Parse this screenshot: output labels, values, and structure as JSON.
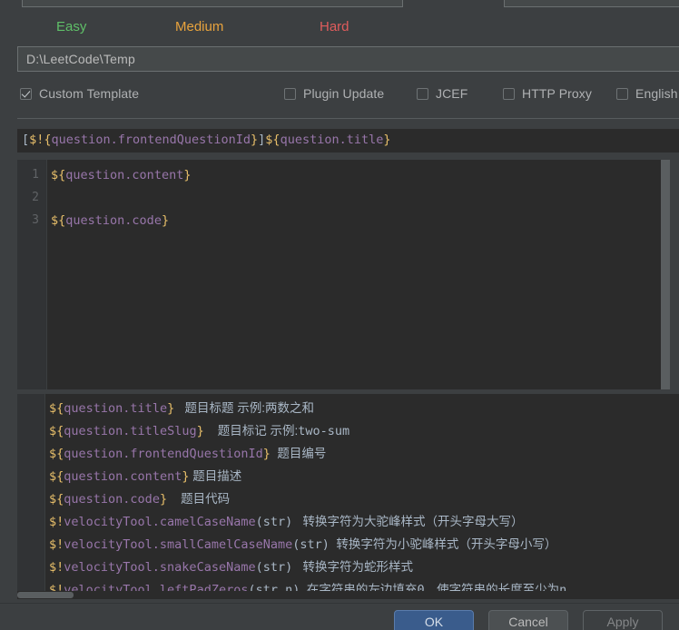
{
  "window": {
    "background": "#3C3F41",
    "editor_background": "#2B2B2B"
  },
  "top_fields": {
    "left_field_value": "",
    "right_field_value": ""
  },
  "difficulty": {
    "items": [
      {
        "label": "Easy",
        "color": "#5FBF68"
      },
      {
        "label": "Medium",
        "color": "#E8A33D"
      },
      {
        "label": "Hard",
        "color": "#E05C5C"
      }
    ]
  },
  "path": {
    "value": "D:\\LeetCode\\Temp",
    "placeholder": "D:\\LeetCode\\Temp"
  },
  "checkboxes": [
    {
      "label": "Custom Template",
      "checked": true
    },
    {
      "label": "Plugin Update",
      "checked": false
    },
    {
      "label": "JCEF",
      "checked": false
    },
    {
      "label": "HTTP Proxy",
      "checked": false
    },
    {
      "label": "English",
      "checked": false
    }
  ],
  "left_glyph": ")",
  "filename_template": {
    "value": "[$!{question.frontendQuestionId}]${question.title}",
    "tokens": [
      {
        "t": "[",
        "c": "tk-punct"
      },
      {
        "t": "$!",
        "c": "tk-dollar"
      },
      {
        "t": "{",
        "c": "tk-brace"
      },
      {
        "t": "question.frontendQuestionId",
        "c": "tk-ident"
      },
      {
        "t": "}",
        "c": "tk-brace"
      },
      {
        "t": "]",
        "c": "tk-punct"
      },
      {
        "t": "$",
        "c": "tk-dollar"
      },
      {
        "t": "{",
        "c": "tk-brace"
      },
      {
        "t": "question.title",
        "c": "tk-ident"
      },
      {
        "t": "}",
        "c": "tk-brace"
      }
    ]
  },
  "code_editor": {
    "lines": [
      {
        "number": "1",
        "text": "${question.content}",
        "tokens": [
          {
            "t": "$",
            "c": "tk-dollar"
          },
          {
            "t": "{",
            "c": "tk-brace"
          },
          {
            "t": "question.content",
            "c": "tk-ident"
          },
          {
            "t": "}",
            "c": "tk-brace"
          }
        ]
      },
      {
        "number": "2",
        "text": "",
        "tokens": []
      },
      {
        "number": "3",
        "text": "${question.code}",
        "tokens": [
          {
            "t": "$",
            "c": "tk-dollar"
          },
          {
            "t": "{",
            "c": "tk-brace"
          },
          {
            "t": "question.code",
            "c": "tk-ident"
          },
          {
            "t": "}",
            "c": "tk-brace"
          }
        ]
      }
    ]
  },
  "hints": {
    "lines": [
      {
        "tokens": [
          {
            "t": "$",
            "c": "tk-dollar"
          },
          {
            "t": "{",
            "c": "tk-brace"
          },
          {
            "t": "question.title",
            "c": "tk-ident"
          },
          {
            "t": "}",
            "c": "tk-brace"
          }
        ],
        "desc": "   题目标题 示例:两数之和",
        "desc_mono": ""
      },
      {
        "tokens": [
          {
            "t": "$",
            "c": "tk-dollar"
          },
          {
            "t": "{",
            "c": "tk-brace"
          },
          {
            "t": "question.titleSlug",
            "c": "tk-ident"
          },
          {
            "t": "}",
            "c": "tk-brace"
          }
        ],
        "desc": "    题目标记 示例:",
        "desc_mono": "two-sum"
      },
      {
        "tokens": [
          {
            "t": "$",
            "c": "tk-dollar"
          },
          {
            "t": "{",
            "c": "tk-brace"
          },
          {
            "t": "question.frontendQuestionId",
            "c": "tk-ident"
          },
          {
            "t": "}",
            "c": "tk-brace"
          }
        ],
        "desc": "  题目编号",
        "desc_mono": ""
      },
      {
        "tokens": [
          {
            "t": "$",
            "c": "tk-dollar"
          },
          {
            "t": "{",
            "c": "tk-brace"
          },
          {
            "t": "question.content",
            "c": "tk-ident"
          },
          {
            "t": "}",
            "c": "tk-brace"
          }
        ],
        "desc": " 题目描述",
        "desc_mono": ""
      },
      {
        "tokens": [
          {
            "t": "$",
            "c": "tk-dollar"
          },
          {
            "t": "{",
            "c": "tk-brace"
          },
          {
            "t": "question.code",
            "c": "tk-ident"
          },
          {
            "t": "}",
            "c": "tk-brace"
          }
        ],
        "desc": "    题目代码",
        "desc_mono": ""
      },
      {
        "tokens": [
          {
            "t": "$!",
            "c": "tk-dollar"
          },
          {
            "t": "velocityTool.camelCaseName",
            "c": "tk-ident"
          },
          {
            "t": "(",
            "c": "tk-punct"
          },
          {
            "t": "str",
            "c": "tk-plain"
          },
          {
            "t": ")",
            "c": "tk-punct"
          }
        ],
        "desc": "   转换字符为大驼峰样式（开头字母大写）",
        "desc_mono": ""
      },
      {
        "tokens": [
          {
            "t": "$!",
            "c": "tk-dollar"
          },
          {
            "t": "velocityTool.smallCamelCaseName",
            "c": "tk-ident"
          },
          {
            "t": "(",
            "c": "tk-punct"
          },
          {
            "t": "str",
            "c": "tk-plain"
          },
          {
            "t": ")",
            "c": "tk-punct"
          }
        ],
        "desc": "  转换字符为小驼峰样式（开头字母小写）",
        "desc_mono": ""
      },
      {
        "tokens": [
          {
            "t": "$!",
            "c": "tk-dollar"
          },
          {
            "t": "velocityTool.snakeCaseName",
            "c": "tk-ident"
          },
          {
            "t": "(",
            "c": "tk-punct"
          },
          {
            "t": "str",
            "c": "tk-plain"
          },
          {
            "t": ")",
            "c": "tk-punct"
          }
        ],
        "desc": "   转换字符为蛇形样式",
        "desc_mono": ""
      },
      {
        "tokens": [
          {
            "t": "$!",
            "c": "tk-dollar"
          },
          {
            "t": "velocityTool.leftPadZeros",
            "c": "tk-ident"
          },
          {
            "t": "(",
            "c": "tk-punct"
          },
          {
            "t": "str",
            "c": "tk-plain"
          },
          {
            "t": ",",
            "c": "tk-dollar"
          },
          {
            "t": "n",
            "c": "tk-plain"
          },
          {
            "t": ")",
            "c": "tk-punct"
          }
        ],
        "desc": "  在字符串的左边填充",
        "desc_mono": "0",
        "desc2": "，使字符串的长度至少为",
        "desc_mono2": "n"
      }
    ]
  },
  "buttons": {
    "ok": "OK",
    "cancel": "Cancel",
    "apply": "Apply"
  }
}
